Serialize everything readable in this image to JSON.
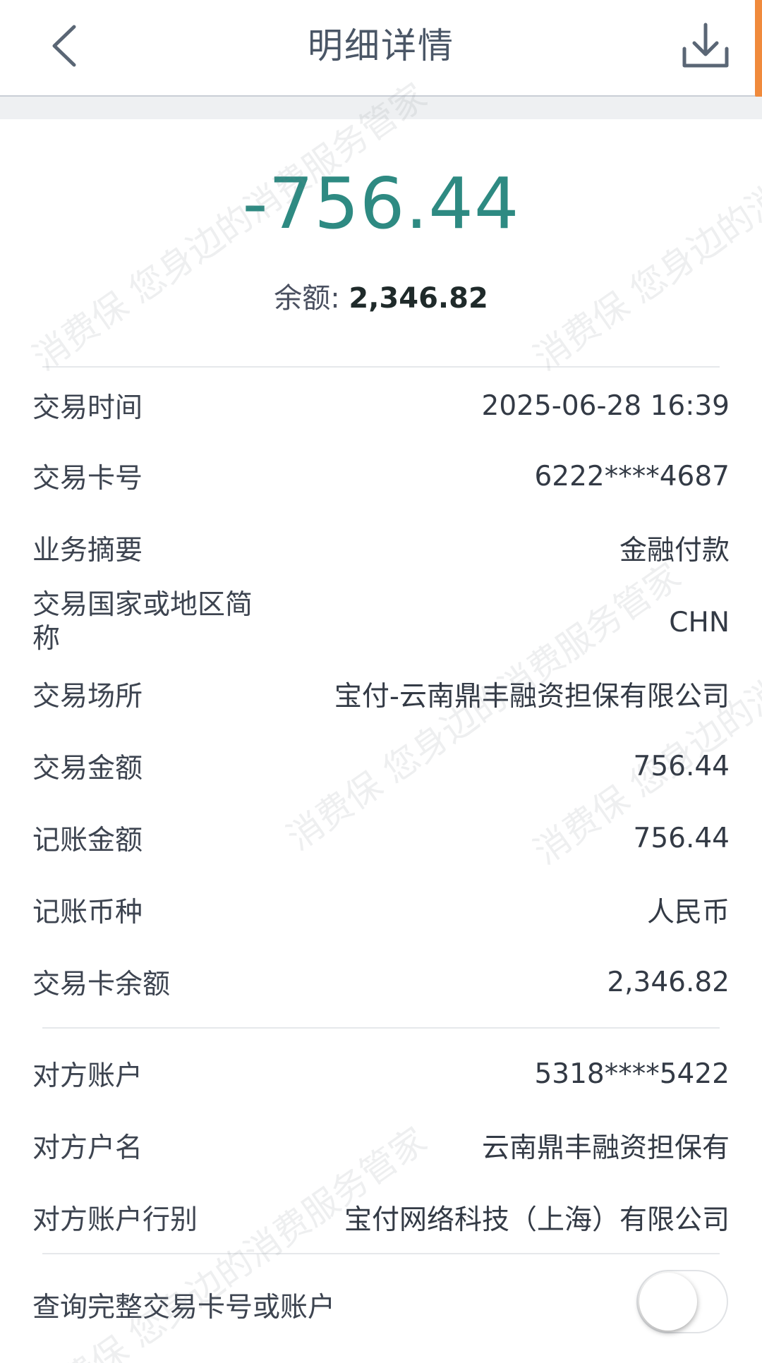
{
  "header": {
    "title": "明细详情"
  },
  "summary": {
    "amount": "-756.44",
    "balance_label": "余额: ",
    "balance_value": "2,346.82"
  },
  "details": [
    {
      "label": "交易时间",
      "value": "2025-06-28 16:39"
    },
    {
      "label": "交易卡号",
      "value": "6222****4687"
    },
    {
      "label": "业务摘要",
      "value": "金融付款"
    },
    {
      "label": "交易国家或地区简称",
      "value": "CHN"
    },
    {
      "label": "交易场所",
      "value": "宝付-云南鼎丰融资担保有限公司"
    },
    {
      "label": "交易金额",
      "value": "756.44"
    },
    {
      "label": "记账金额",
      "value": "756.44"
    },
    {
      "label": "记账币种",
      "value": "人民币"
    },
    {
      "label": "交易卡余额",
      "value": "2,346.82"
    }
  ],
  "counterparty": [
    {
      "label": "对方账户",
      "value": "5318****5422"
    },
    {
      "label": "对方户名",
      "value": "云南鼎丰融资担保有"
    },
    {
      "label": "对方账户行别",
      "value": "宝付网络科技（上海）有限公司"
    }
  ],
  "query_full": {
    "label": "查询完整交易卡号或账户",
    "enabled": false
  },
  "watermark": {
    "text": "消费保 您身边的消费服务管家"
  },
  "colors": {
    "amount": "#2e8a82",
    "scroll_indicator": "#f08a3c"
  },
  "icons": {
    "back": "chevron-left-icon",
    "download": "download-icon"
  }
}
